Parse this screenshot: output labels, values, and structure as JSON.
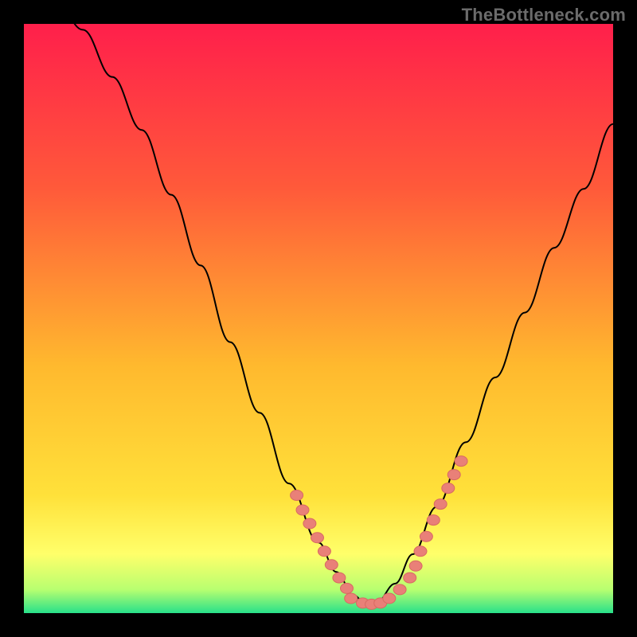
{
  "watermark": "TheBottleneck.com",
  "colors": {
    "gradient_stops": {
      "c0": "#ff1f4b",
      "c1": "#ff5a3a",
      "c2": "#ffb92e",
      "c3": "#ffe13a",
      "c4": "#ffff6a",
      "c5": "#b8ff70",
      "c6": "#28e08a"
    },
    "curve": "#000000",
    "marker_fill": "#e98078",
    "marker_stroke": "#d86a62"
  },
  "chart_data": {
    "type": "line",
    "title": "",
    "xlabel": "",
    "ylabel": "",
    "xlim": [
      0,
      1
    ],
    "ylim": [
      0,
      1
    ],
    "note": "Bottleneck-style V-curve. y represents mismatch severity; minimum near x≈0.58.",
    "x": [
      0.0,
      0.05,
      0.1,
      0.15,
      0.2,
      0.25,
      0.3,
      0.35,
      0.4,
      0.45,
      0.5,
      0.53,
      0.56,
      0.58,
      0.6,
      0.63,
      0.66,
      0.7,
      0.75,
      0.8,
      0.85,
      0.9,
      0.95,
      1.0
    ],
    "y": [
      1.1,
      1.05,
      0.99,
      0.91,
      0.82,
      0.71,
      0.59,
      0.46,
      0.34,
      0.22,
      0.12,
      0.07,
      0.03,
      0.015,
      0.02,
      0.05,
      0.1,
      0.18,
      0.29,
      0.4,
      0.51,
      0.62,
      0.72,
      0.83
    ],
    "markers_left": {
      "x": [
        0.463,
        0.473,
        0.485,
        0.498,
        0.51,
        0.522,
        0.535,
        0.548
      ],
      "y": [
        0.2,
        0.175,
        0.152,
        0.128,
        0.105,
        0.082,
        0.06,
        0.042
      ]
    },
    "markers_bottom": {
      "x": [
        0.555,
        0.575,
        0.59,
        0.605,
        0.62,
        0.638,
        0.655
      ],
      "y": [
        0.025,
        0.017,
        0.015,
        0.017,
        0.025,
        0.04,
        0.06
      ]
    },
    "markers_right": {
      "x": [
        0.665,
        0.673,
        0.683,
        0.695,
        0.707,
        0.72,
        0.73,
        0.742
      ],
      "y": [
        0.08,
        0.105,
        0.13,
        0.158,
        0.185,
        0.212,
        0.235,
        0.258
      ]
    }
  }
}
